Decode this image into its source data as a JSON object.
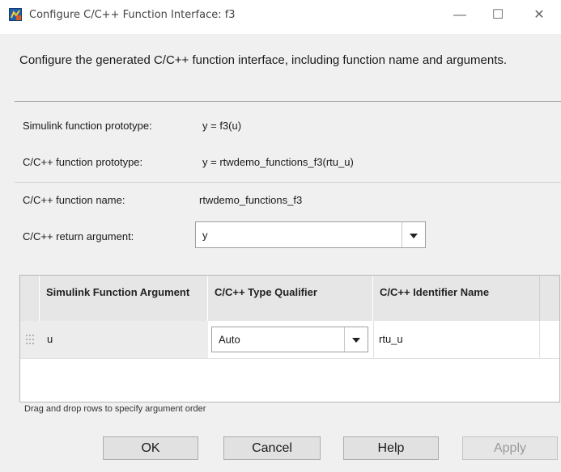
{
  "window": {
    "title": "Configure C/C++ Function Interface: f3",
    "minimize_glyph": "—",
    "maximize_glyph": "☐",
    "close_glyph": "✕"
  },
  "description": "Configure the generated C/C++ function interface, including function name and arguments.",
  "fields": {
    "simulink_prototype_label": "Simulink function prototype:",
    "simulink_prototype_value": "y = f3(u)",
    "c_prototype_label": "C/C++ function prototype:",
    "c_prototype_value": "y = rtwdemo_functions_f3(rtu_u)",
    "c_name_label": "C/C++ function name:",
    "c_name_value": "rtwdemo_functions_f3",
    "return_arg_label": "C/C++ return argument:",
    "return_arg_value": "y"
  },
  "table": {
    "columns": [
      "Simulink Function Argument",
      "C/C++ Type Qualifier",
      "C/C++ Identifier Name"
    ],
    "rows": [
      {
        "argument": "u",
        "qualifier": "Auto",
        "identifier": "rtu_u"
      }
    ]
  },
  "hint": "Drag and drop rows to specify argument order",
  "buttons": {
    "ok": "OK",
    "cancel": "Cancel",
    "help": "Help",
    "apply": "Apply"
  }
}
